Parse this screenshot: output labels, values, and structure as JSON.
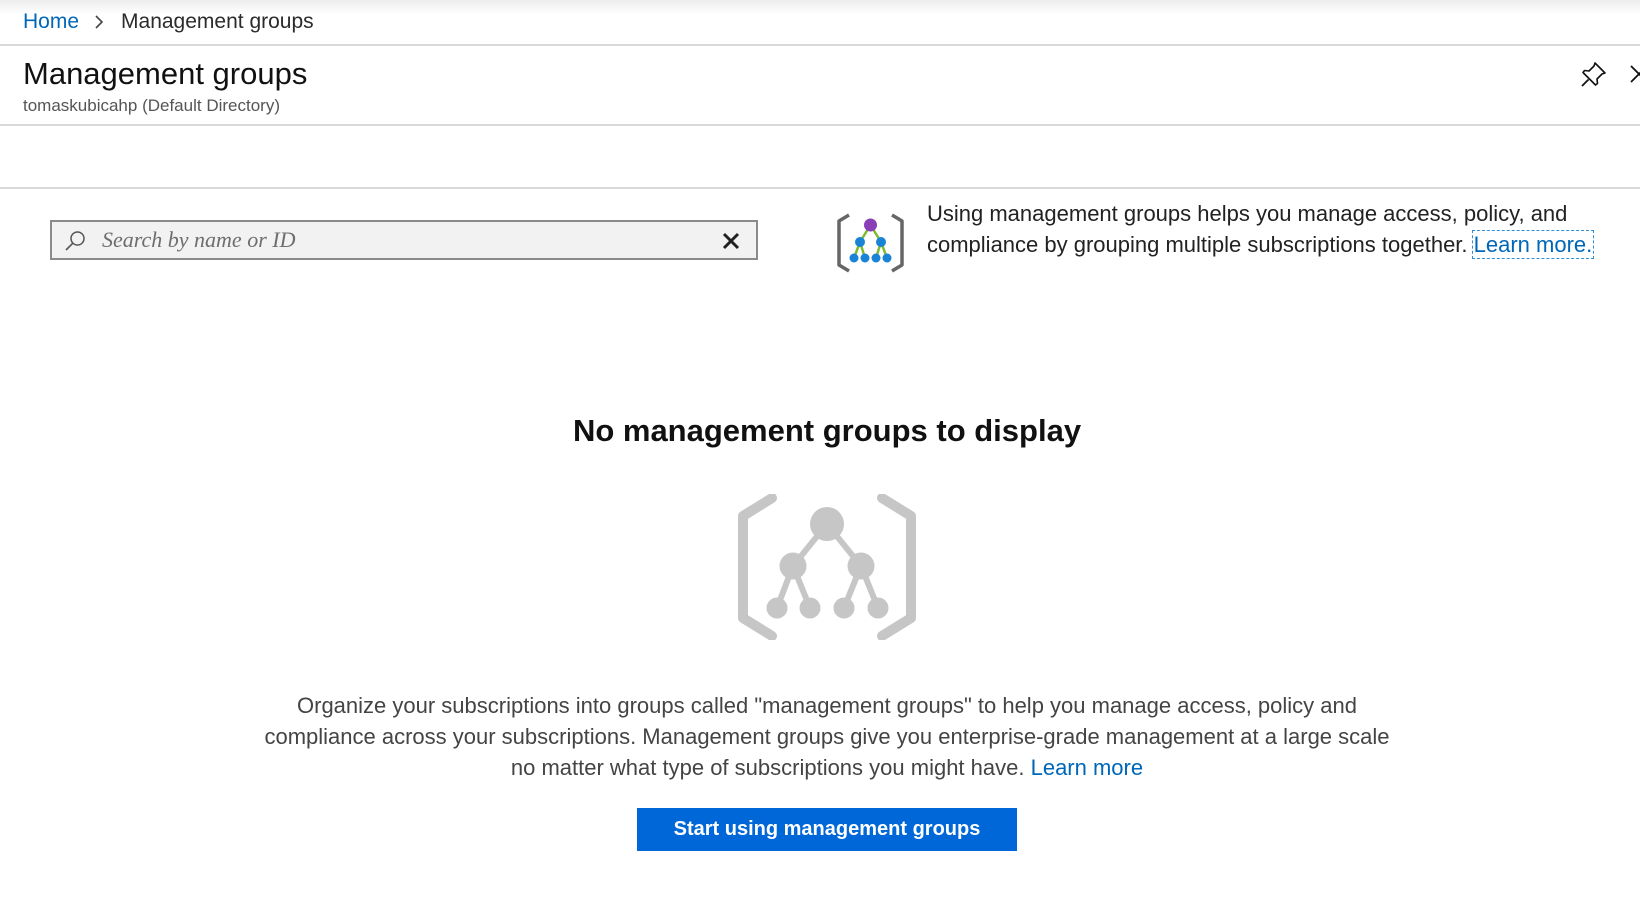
{
  "breadcrumb": {
    "home": "Home",
    "current": "Management groups"
  },
  "header": {
    "title": "Management groups",
    "subtitle": "tomaskubicahp (Default Directory)"
  },
  "search": {
    "placeholder": "Search by name or ID",
    "value": ""
  },
  "info": {
    "text": "Using management groups helps you manage access, policy, and compliance by grouping multiple subscriptions together. ",
    "link": "Learn more."
  },
  "empty_state": {
    "title": "No management groups to display",
    "description": "Organize your subscriptions into groups called \"management groups\" to help you manage access, policy and compliance across your subscriptions. Management groups give you enterprise-grade management at a large scale no matter what type of subscriptions you might have. ",
    "link": "Learn more",
    "button": "Start using management groups"
  },
  "icons": {
    "breadcrumb_separator": "chevron-right-icon",
    "pin": "pin-icon",
    "close": "close-icon",
    "search": "search-icon",
    "clear": "clear-icon",
    "info": "management-groups-icon",
    "illustration": "management-groups-illustration"
  },
  "colors": {
    "link": "#0067b8",
    "primary_button": "#0067d8",
    "illustration_gray": "#c6c6c6",
    "icon_purple": "#8a3fb6",
    "icon_blue": "#1a83d6",
    "icon_green": "#7dbb2f"
  }
}
